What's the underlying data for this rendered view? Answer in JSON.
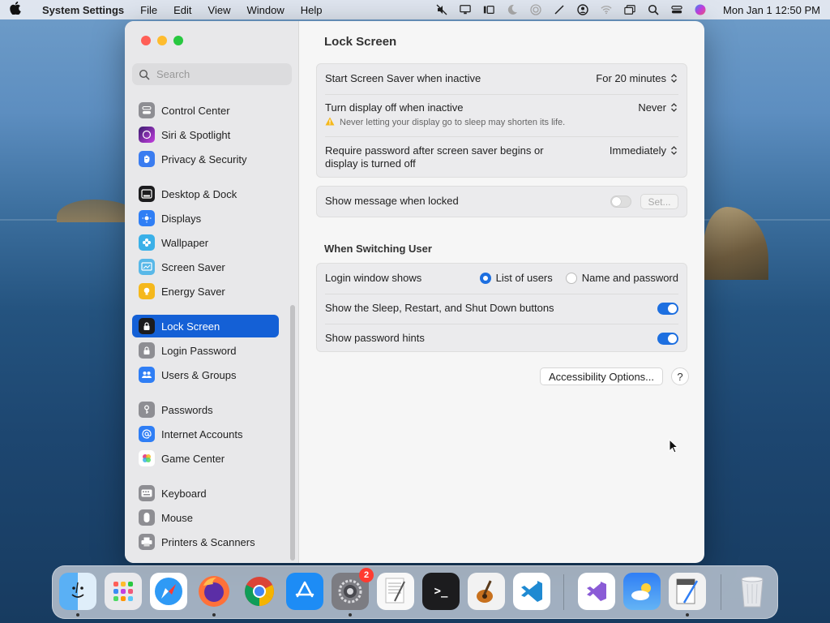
{
  "menubar": {
    "app_name": "System Settings",
    "menus": [
      "File",
      "Edit",
      "View",
      "Window",
      "Help"
    ],
    "clock": "Mon Jan 1  12:50 PM"
  },
  "window": {
    "search": {
      "placeholder": "Search"
    },
    "sidebar": {
      "items": [
        {
          "label": "Control Center",
          "icon": "control-center-icon",
          "color": "#8e8e93"
        },
        {
          "label": "Siri & Spotlight",
          "icon": "siri-icon",
          "color": "#b83bd8"
        },
        {
          "label": "Privacy & Security",
          "icon": "hand-icon",
          "color": "#3a7cf0"
        },
        {
          "label": "Desktop & Dock",
          "icon": "dock-icon",
          "color": "#1c1c1e"
        },
        {
          "label": "Displays",
          "icon": "sun-icon",
          "color": "#2f7ef5"
        },
        {
          "label": "Wallpaper",
          "icon": "flower-icon",
          "color": "#3ab0e8"
        },
        {
          "label": "Screen Saver",
          "icon": "screen-saver-icon",
          "color": "#58b8e8"
        },
        {
          "label": "Energy Saver",
          "icon": "bulb-icon",
          "color": "#f5b81c"
        },
        {
          "label": "Lock Screen",
          "icon": "lock-icon",
          "color": "#1c1c1e",
          "active": true
        },
        {
          "label": "Login Password",
          "icon": "lock-icon",
          "color": "#8e8e93"
        },
        {
          "label": "Users & Groups",
          "icon": "users-icon",
          "color": "#2f7ef5"
        },
        {
          "label": "Passwords",
          "icon": "key-icon",
          "color": "#8e8e93"
        },
        {
          "label": "Internet Accounts",
          "icon": "at-icon",
          "color": "#2f7ef5"
        },
        {
          "label": "Game Center",
          "icon": "game-center-icon",
          "color": "#e84a8a"
        },
        {
          "label": "Keyboard",
          "icon": "keyboard-icon",
          "color": "#8e8e93"
        },
        {
          "label": "Mouse",
          "icon": "mouse-icon",
          "color": "#8e8e93"
        },
        {
          "label": "Printers & Scanners",
          "icon": "printer-icon",
          "color": "#8e8e93"
        }
      ]
    },
    "main": {
      "title": "Lock Screen",
      "screen_saver_label": "Start Screen Saver when inactive",
      "screen_saver_value": "For 20 minutes",
      "display_off_label": "Turn display off when inactive",
      "display_off_value": "Never",
      "display_off_warning": "Never letting your display go to sleep may shorten its life.",
      "require_password_label": "Require password after screen saver begins or display is turned off",
      "require_password_value": "Immediately",
      "show_message_label": "Show message when locked",
      "show_message_on": false,
      "set_button": "Set...",
      "switching_title": "When Switching User",
      "login_window_label": "Login window shows",
      "login_option_1": "List of users",
      "login_option_2": "Name and password",
      "login_selected": "List of users",
      "sleep_buttons_label": "Show the Sleep, Restart, and Shut Down buttons",
      "sleep_buttons_on": true,
      "password_hints_label": "Show password hints",
      "password_hints_on": true,
      "accessibility_button": "Accessibility Options...",
      "help_button": "?"
    }
  },
  "dock": {
    "badge_count": "2",
    "apps": [
      "Finder",
      "Launchpad",
      "Safari",
      "Firefox",
      "Chrome",
      "App Store",
      "System Settings",
      "TextEdit",
      "Terminal",
      "GarageBand",
      "VS Code",
      "Visual Studio",
      "Weather",
      "Script Editor",
      "Trash"
    ]
  },
  "colors": {
    "accent": "#1460d6",
    "toggle_on": "#1d6fe0"
  }
}
